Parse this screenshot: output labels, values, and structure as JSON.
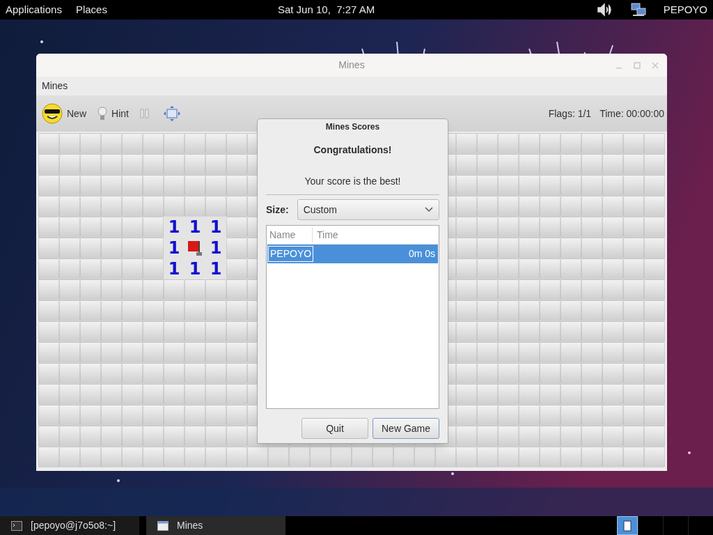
{
  "top_panel": {
    "menus": [
      "Applications",
      "Places"
    ],
    "clock": "Sat Jun 10,  7:27 AM",
    "user": "PEPOYO"
  },
  "window": {
    "title": "Mines",
    "menu": [
      "Mines"
    ],
    "toolbar": {
      "new": "New",
      "hint": "Hint",
      "flags": "Flags: 1/1",
      "time": "Time: 00:00:00"
    },
    "board": {
      "rows": [
        {
          "cells": [
            {
              "kind": "hidden"
            },
            {
              "kind": "hidden"
            },
            {
              "kind": "hidden"
            },
            {
              "kind": "hidden"
            },
            {
              "kind": "hidden"
            },
            {
              "kind": "hidden"
            },
            {
              "kind": "hidden"
            },
            {
              "kind": "hidden"
            },
            {
              "kind": "hidden"
            },
            {
              "kind": "hidden"
            },
            {
              "kind": "hidden"
            },
            {
              "kind": "covered"
            },
            {
              "kind": "covered"
            },
            {
              "kind": "covered"
            },
            {
              "kind": "covered"
            },
            {
              "kind": "covered"
            },
            {
              "kind": "covered"
            },
            {
              "kind": "covered"
            },
            {
              "kind": "covered"
            },
            {
              "kind": "hidden"
            },
            {
              "kind": "hidden"
            },
            {
              "kind": "hidden"
            },
            {
              "kind": "hidden"
            },
            {
              "kind": "hidden"
            },
            {
              "kind": "hidden"
            },
            {
              "kind": "hidden"
            },
            {
              "kind": "hidden"
            },
            {
              "kind": "hidden"
            },
            {
              "kind": "hidden"
            },
            {
              "kind": "hidden"
            }
          ]
        },
        {
          "cells": [
            {
              "kind": "hidden"
            },
            {
              "kind": "hidden"
            },
            {
              "kind": "hidden"
            },
            {
              "kind": "hidden"
            },
            {
              "kind": "hidden"
            },
            {
              "kind": "hidden"
            },
            {
              "kind": "hidden"
            },
            {
              "kind": "hidden"
            },
            {
              "kind": "hidden"
            },
            {
              "kind": "hidden"
            },
            {
              "kind": "hidden"
            },
            {
              "kind": "covered"
            },
            {
              "kind": "covered"
            },
            {
              "kind": "covered"
            },
            {
              "kind": "covered"
            },
            {
              "kind": "covered"
            },
            {
              "kind": "covered"
            },
            {
              "kind": "covered"
            },
            {
              "kind": "covered"
            },
            {
              "kind": "hidden"
            },
            {
              "kind": "hidden"
            },
            {
              "kind": "hidden"
            },
            {
              "kind": "hidden"
            },
            {
              "kind": "hidden"
            },
            {
              "kind": "hidden"
            },
            {
              "kind": "hidden"
            },
            {
              "kind": "hidden"
            },
            {
              "kind": "hidden"
            },
            {
              "kind": "hidden"
            },
            {
              "kind": "hidden"
            }
          ]
        },
        {
          "cells": [
            {
              "kind": "hidden"
            },
            {
              "kind": "hidden"
            },
            {
              "kind": "hidden"
            },
            {
              "kind": "hidden"
            },
            {
              "kind": "hidden"
            },
            {
              "kind": "hidden"
            },
            {
              "kind": "hidden"
            },
            {
              "kind": "hidden"
            },
            {
              "kind": "hidden"
            },
            {
              "kind": "hidden"
            },
            {
              "kind": "hidden"
            },
            {
              "kind": "covered"
            },
            {
              "kind": "covered"
            },
            {
              "kind": "covered"
            },
            {
              "kind": "covered"
            },
            {
              "kind": "covered"
            },
            {
              "kind": "covered"
            },
            {
              "kind": "covered"
            },
            {
              "kind": "covered"
            },
            {
              "kind": "hidden"
            },
            {
              "kind": "hidden"
            },
            {
              "kind": "hidden"
            },
            {
              "kind": "hidden"
            },
            {
              "kind": "hidden"
            },
            {
              "kind": "hidden"
            },
            {
              "kind": "hidden"
            },
            {
              "kind": "hidden"
            },
            {
              "kind": "hidden"
            },
            {
              "kind": "hidden"
            },
            {
              "kind": "hidden"
            }
          ]
        },
        {
          "cells": [
            {
              "kind": "hidden"
            },
            {
              "kind": "hidden"
            },
            {
              "kind": "hidden"
            },
            {
              "kind": "hidden"
            },
            {
              "kind": "hidden"
            },
            {
              "kind": "hidden"
            },
            {
              "kind": "hidden"
            },
            {
              "kind": "hidden"
            },
            {
              "kind": "hidden"
            },
            {
              "kind": "hidden"
            },
            {
              "kind": "hidden"
            },
            {
              "kind": "covered"
            },
            {
              "kind": "covered"
            },
            {
              "kind": "covered"
            },
            {
              "kind": "covered"
            },
            {
              "kind": "covered"
            },
            {
              "kind": "covered"
            },
            {
              "kind": "covered"
            },
            {
              "kind": "covered"
            },
            {
              "kind": "hidden"
            },
            {
              "kind": "hidden"
            },
            {
              "kind": "hidden"
            },
            {
              "kind": "hidden"
            },
            {
              "kind": "hidden"
            },
            {
              "kind": "hidden"
            },
            {
              "kind": "hidden"
            },
            {
              "kind": "hidden"
            },
            {
              "kind": "hidden"
            },
            {
              "kind": "hidden"
            },
            {
              "kind": "hidden"
            }
          ]
        },
        {
          "cells": [
            {
              "kind": "hidden"
            },
            {
              "kind": "hidden"
            },
            {
              "kind": "hidden"
            },
            {
              "kind": "hidden"
            },
            {
              "kind": "hidden"
            },
            {
              "kind": "hidden"
            },
            {
              "kind": "number",
              "text": "1"
            },
            {
              "kind": "number",
              "text": "1"
            },
            {
              "kind": "number",
              "text": "1"
            },
            {
              "kind": "hidden"
            },
            {
              "kind": "hidden"
            },
            {
              "kind": "covered"
            },
            {
              "kind": "covered"
            },
            {
              "kind": "covered"
            },
            {
              "kind": "covered"
            },
            {
              "kind": "covered"
            },
            {
              "kind": "covered"
            },
            {
              "kind": "covered"
            },
            {
              "kind": "covered"
            },
            {
              "kind": "hidden"
            },
            {
              "kind": "hidden"
            },
            {
              "kind": "hidden"
            },
            {
              "kind": "hidden"
            },
            {
              "kind": "hidden"
            },
            {
              "kind": "hidden"
            },
            {
              "kind": "hidden"
            },
            {
              "kind": "hidden"
            },
            {
              "kind": "hidden"
            },
            {
              "kind": "hidden"
            },
            {
              "kind": "hidden"
            }
          ]
        },
        {
          "cells": [
            {
              "kind": "hidden"
            },
            {
              "kind": "hidden"
            },
            {
              "kind": "hidden"
            },
            {
              "kind": "hidden"
            },
            {
              "kind": "hidden"
            },
            {
              "kind": "hidden"
            },
            {
              "kind": "number",
              "text": "1"
            },
            {
              "kind": "flag"
            },
            {
              "kind": "number",
              "text": "1"
            },
            {
              "kind": "hidden"
            },
            {
              "kind": "hidden"
            },
            {
              "kind": "covered"
            },
            {
              "kind": "covered"
            },
            {
              "kind": "covered"
            },
            {
              "kind": "covered"
            },
            {
              "kind": "covered"
            },
            {
              "kind": "covered"
            },
            {
              "kind": "covered"
            },
            {
              "kind": "covered"
            },
            {
              "kind": "hidden"
            },
            {
              "kind": "hidden"
            },
            {
              "kind": "hidden"
            },
            {
              "kind": "hidden"
            },
            {
              "kind": "hidden"
            },
            {
              "kind": "hidden"
            },
            {
              "kind": "hidden"
            },
            {
              "kind": "hidden"
            },
            {
              "kind": "hidden"
            },
            {
              "kind": "hidden"
            },
            {
              "kind": "hidden"
            }
          ]
        },
        {
          "cells": [
            {
              "kind": "hidden"
            },
            {
              "kind": "hidden"
            },
            {
              "kind": "hidden"
            },
            {
              "kind": "hidden"
            },
            {
              "kind": "hidden"
            },
            {
              "kind": "hidden"
            },
            {
              "kind": "number",
              "text": "1"
            },
            {
              "kind": "number",
              "text": "1"
            },
            {
              "kind": "number",
              "text": "1"
            },
            {
              "kind": "hidden"
            },
            {
              "kind": "hidden"
            },
            {
              "kind": "covered"
            },
            {
              "kind": "covered"
            },
            {
              "kind": "covered"
            },
            {
              "kind": "covered"
            },
            {
              "kind": "covered"
            },
            {
              "kind": "covered"
            },
            {
              "kind": "covered"
            },
            {
              "kind": "covered"
            },
            {
              "kind": "hidden"
            },
            {
              "kind": "hidden"
            },
            {
              "kind": "hidden"
            },
            {
              "kind": "hidden"
            },
            {
              "kind": "hidden"
            },
            {
              "kind": "hidden"
            },
            {
              "kind": "hidden"
            },
            {
              "kind": "hidden"
            },
            {
              "kind": "hidden"
            },
            {
              "kind": "hidden"
            },
            {
              "kind": "hidden"
            }
          ]
        },
        {
          "cells": [
            {
              "kind": "hidden"
            },
            {
              "kind": "hidden"
            },
            {
              "kind": "hidden"
            },
            {
              "kind": "hidden"
            },
            {
              "kind": "hidden"
            },
            {
              "kind": "hidden"
            },
            {
              "kind": "hidden"
            },
            {
              "kind": "hidden"
            },
            {
              "kind": "hidden"
            },
            {
              "kind": "hidden"
            },
            {
              "kind": "hidden"
            },
            {
              "kind": "covered"
            },
            {
              "kind": "covered"
            },
            {
              "kind": "covered"
            },
            {
              "kind": "covered"
            },
            {
              "kind": "covered"
            },
            {
              "kind": "covered"
            },
            {
              "kind": "covered"
            },
            {
              "kind": "covered"
            },
            {
              "kind": "hidden"
            },
            {
              "kind": "hidden"
            },
            {
              "kind": "hidden"
            },
            {
              "kind": "hidden"
            },
            {
              "kind": "hidden"
            },
            {
              "kind": "hidden"
            },
            {
              "kind": "hidden"
            },
            {
              "kind": "hidden"
            },
            {
              "kind": "hidden"
            },
            {
              "kind": "hidden"
            },
            {
              "kind": "hidden"
            }
          ]
        },
        {
          "cells": [
            {
              "kind": "hidden"
            },
            {
              "kind": "hidden"
            },
            {
              "kind": "hidden"
            },
            {
              "kind": "hidden"
            },
            {
              "kind": "hidden"
            },
            {
              "kind": "hidden"
            },
            {
              "kind": "hidden"
            },
            {
              "kind": "hidden"
            },
            {
              "kind": "hidden"
            },
            {
              "kind": "hidden"
            },
            {
              "kind": "hidden"
            },
            {
              "kind": "covered"
            },
            {
              "kind": "covered"
            },
            {
              "kind": "covered"
            },
            {
              "kind": "covered"
            },
            {
              "kind": "covered"
            },
            {
              "kind": "covered"
            },
            {
              "kind": "covered"
            },
            {
              "kind": "covered"
            },
            {
              "kind": "hidden"
            },
            {
              "kind": "hidden"
            },
            {
              "kind": "hidden"
            },
            {
              "kind": "hidden"
            },
            {
              "kind": "hidden"
            },
            {
              "kind": "hidden"
            },
            {
              "kind": "hidden"
            },
            {
              "kind": "hidden"
            },
            {
              "kind": "hidden"
            },
            {
              "kind": "hidden"
            },
            {
              "kind": "hidden"
            }
          ]
        },
        {
          "cells": [
            {
              "kind": "hidden"
            },
            {
              "kind": "hidden"
            },
            {
              "kind": "hidden"
            },
            {
              "kind": "hidden"
            },
            {
              "kind": "hidden"
            },
            {
              "kind": "hidden"
            },
            {
              "kind": "hidden"
            },
            {
              "kind": "hidden"
            },
            {
              "kind": "hidden"
            },
            {
              "kind": "hidden"
            },
            {
              "kind": "hidden"
            },
            {
              "kind": "covered"
            },
            {
              "kind": "covered"
            },
            {
              "kind": "covered"
            },
            {
              "kind": "covered"
            },
            {
              "kind": "covered"
            },
            {
              "kind": "covered"
            },
            {
              "kind": "covered"
            },
            {
              "kind": "covered"
            },
            {
              "kind": "hidden"
            },
            {
              "kind": "hidden"
            },
            {
              "kind": "hidden"
            },
            {
              "kind": "hidden"
            },
            {
              "kind": "hidden"
            },
            {
              "kind": "hidden"
            },
            {
              "kind": "hidden"
            },
            {
              "kind": "hidden"
            },
            {
              "kind": "hidden"
            },
            {
              "kind": "hidden"
            },
            {
              "kind": "hidden"
            }
          ]
        },
        {
          "cells": [
            {
              "kind": "hidden"
            },
            {
              "kind": "hidden"
            },
            {
              "kind": "hidden"
            },
            {
              "kind": "hidden"
            },
            {
              "kind": "hidden"
            },
            {
              "kind": "hidden"
            },
            {
              "kind": "hidden"
            },
            {
              "kind": "hidden"
            },
            {
              "kind": "hidden"
            },
            {
              "kind": "hidden"
            },
            {
              "kind": "hidden"
            },
            {
              "kind": "covered"
            },
            {
              "kind": "covered"
            },
            {
              "kind": "covered"
            },
            {
              "kind": "covered"
            },
            {
              "kind": "covered"
            },
            {
              "kind": "covered"
            },
            {
              "kind": "covered"
            },
            {
              "kind": "covered"
            },
            {
              "kind": "hidden"
            },
            {
              "kind": "hidden"
            },
            {
              "kind": "hidden"
            },
            {
              "kind": "hidden"
            },
            {
              "kind": "hidden"
            },
            {
              "kind": "hidden"
            },
            {
              "kind": "hidden"
            },
            {
              "kind": "hidden"
            },
            {
              "kind": "hidden"
            },
            {
              "kind": "hidden"
            },
            {
              "kind": "hidden"
            }
          ]
        },
        {
          "cells": [
            {
              "kind": "hidden"
            },
            {
              "kind": "hidden"
            },
            {
              "kind": "hidden"
            },
            {
              "kind": "hidden"
            },
            {
              "kind": "hidden"
            },
            {
              "kind": "hidden"
            },
            {
              "kind": "hidden"
            },
            {
              "kind": "hidden"
            },
            {
              "kind": "hidden"
            },
            {
              "kind": "hidden"
            },
            {
              "kind": "hidden"
            },
            {
              "kind": "covered"
            },
            {
              "kind": "covered"
            },
            {
              "kind": "covered"
            },
            {
              "kind": "covered"
            },
            {
              "kind": "covered"
            },
            {
              "kind": "covered"
            },
            {
              "kind": "covered"
            },
            {
              "kind": "covered"
            },
            {
              "kind": "hidden"
            },
            {
              "kind": "hidden"
            },
            {
              "kind": "hidden"
            },
            {
              "kind": "hidden"
            },
            {
              "kind": "hidden"
            },
            {
              "kind": "hidden"
            },
            {
              "kind": "hidden"
            },
            {
              "kind": "hidden"
            },
            {
              "kind": "hidden"
            },
            {
              "kind": "hidden"
            },
            {
              "kind": "hidden"
            }
          ]
        },
        {
          "cells": [
            {
              "kind": "hidden"
            },
            {
              "kind": "hidden"
            },
            {
              "kind": "hidden"
            },
            {
              "kind": "hidden"
            },
            {
              "kind": "hidden"
            },
            {
              "kind": "hidden"
            },
            {
              "kind": "hidden"
            },
            {
              "kind": "hidden"
            },
            {
              "kind": "hidden"
            },
            {
              "kind": "hidden"
            },
            {
              "kind": "hidden"
            },
            {
              "kind": "covered"
            },
            {
              "kind": "covered"
            },
            {
              "kind": "covered"
            },
            {
              "kind": "covered"
            },
            {
              "kind": "covered"
            },
            {
              "kind": "covered"
            },
            {
              "kind": "covered"
            },
            {
              "kind": "covered"
            },
            {
              "kind": "hidden"
            },
            {
              "kind": "hidden"
            },
            {
              "kind": "hidden"
            },
            {
              "kind": "hidden"
            },
            {
              "kind": "hidden"
            },
            {
              "kind": "hidden"
            },
            {
              "kind": "hidden"
            },
            {
              "kind": "hidden"
            },
            {
              "kind": "hidden"
            },
            {
              "kind": "hidden"
            },
            {
              "kind": "hidden"
            }
          ]
        },
        {
          "cells": [
            {
              "kind": "hidden"
            },
            {
              "kind": "hidden"
            },
            {
              "kind": "hidden"
            },
            {
              "kind": "hidden"
            },
            {
              "kind": "hidden"
            },
            {
              "kind": "hidden"
            },
            {
              "kind": "hidden"
            },
            {
              "kind": "hidden"
            },
            {
              "kind": "hidden"
            },
            {
              "kind": "hidden"
            },
            {
              "kind": "hidden"
            },
            {
              "kind": "covered"
            },
            {
              "kind": "covered"
            },
            {
              "kind": "covered"
            },
            {
              "kind": "covered"
            },
            {
              "kind": "covered"
            },
            {
              "kind": "covered"
            },
            {
              "kind": "covered"
            },
            {
              "kind": "covered"
            },
            {
              "kind": "hidden"
            },
            {
              "kind": "hidden"
            },
            {
              "kind": "hidden"
            },
            {
              "kind": "hidden"
            },
            {
              "kind": "hidden"
            },
            {
              "kind": "hidden"
            },
            {
              "kind": "hidden"
            },
            {
              "kind": "hidden"
            },
            {
              "kind": "hidden"
            },
            {
              "kind": "hidden"
            },
            {
              "kind": "hidden"
            }
          ]
        },
        {
          "cells": [
            {
              "kind": "hidden"
            },
            {
              "kind": "hidden"
            },
            {
              "kind": "hidden"
            },
            {
              "kind": "hidden"
            },
            {
              "kind": "hidden"
            },
            {
              "kind": "hidden"
            },
            {
              "kind": "hidden"
            },
            {
              "kind": "hidden"
            },
            {
              "kind": "hidden"
            },
            {
              "kind": "hidden"
            },
            {
              "kind": "hidden"
            },
            {
              "kind": "hidden"
            },
            {
              "kind": "hidden"
            },
            {
              "kind": "hidden"
            },
            {
              "kind": "hidden"
            },
            {
              "kind": "hidden"
            },
            {
              "kind": "hidden"
            },
            {
              "kind": "hidden"
            },
            {
              "kind": "hidden"
            },
            {
              "kind": "hidden"
            },
            {
              "kind": "hidden"
            },
            {
              "kind": "hidden"
            },
            {
              "kind": "hidden"
            },
            {
              "kind": "hidden"
            },
            {
              "kind": "hidden"
            },
            {
              "kind": "hidden"
            },
            {
              "kind": "hidden"
            },
            {
              "kind": "hidden"
            },
            {
              "kind": "hidden"
            },
            {
              "kind": "hidden"
            }
          ]
        },
        {
          "cells": [
            {
              "kind": "hidden"
            },
            {
              "kind": "hidden"
            },
            {
              "kind": "hidden"
            },
            {
              "kind": "hidden"
            },
            {
              "kind": "hidden"
            },
            {
              "kind": "hidden"
            },
            {
              "kind": "hidden"
            },
            {
              "kind": "hidden"
            },
            {
              "kind": "hidden"
            },
            {
              "kind": "hidden"
            },
            {
              "kind": "hidden"
            },
            {
              "kind": "hidden"
            },
            {
              "kind": "hidden"
            },
            {
              "kind": "hidden"
            },
            {
              "kind": "hidden"
            },
            {
              "kind": "hidden"
            },
            {
              "kind": "hidden"
            },
            {
              "kind": "hidden"
            },
            {
              "kind": "hidden"
            },
            {
              "kind": "hidden"
            },
            {
              "kind": "hidden"
            },
            {
              "kind": "hidden"
            },
            {
              "kind": "hidden"
            },
            {
              "kind": "hidden"
            },
            {
              "kind": "hidden"
            },
            {
              "kind": "hidden"
            },
            {
              "kind": "hidden"
            },
            {
              "kind": "hidden"
            },
            {
              "kind": "hidden"
            },
            {
              "kind": "hidden"
            }
          ]
        }
      ]
    }
  },
  "dialog": {
    "title": "Mines Scores",
    "heading": "Congratulations!",
    "message": "Your score is the best!",
    "size_label": "Size:",
    "size_value": "Custom",
    "columns": [
      "Name",
      "Time"
    ],
    "rows": [
      {
        "name": "PEPOYO",
        "time": "0m 0s",
        "selected": true
      }
    ],
    "buttons": [
      "Quit",
      "New Game"
    ]
  },
  "taskbar": {
    "items": [
      {
        "label": "[pepoyo@j7o5o8:~]",
        "kind": "terminal",
        "selected": false
      },
      {
        "label": "Mines",
        "kind": "window",
        "selected": true
      }
    ]
  }
}
